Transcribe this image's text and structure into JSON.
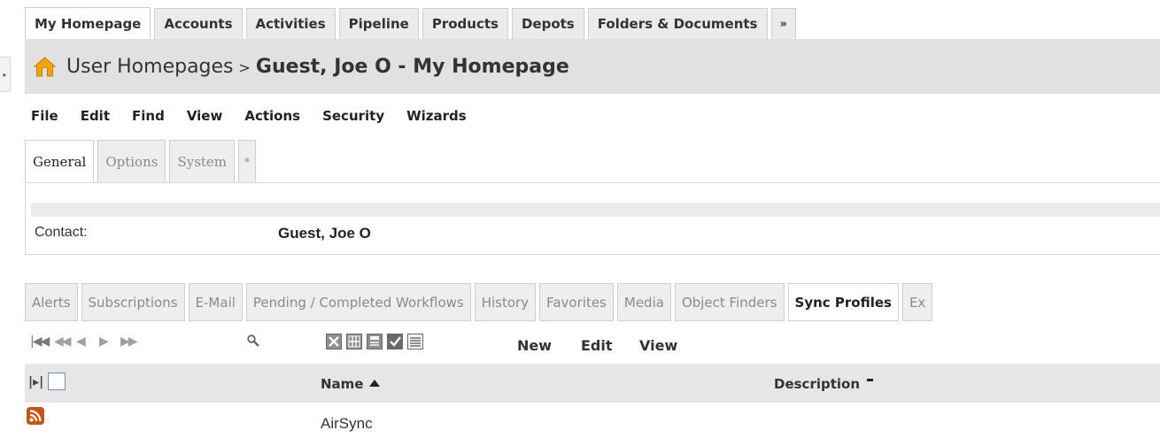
{
  "top_tabs": [
    "My Homepage",
    "Accounts",
    "Activities",
    "Pipeline",
    "Products",
    "Depots",
    "Folders & Documents",
    "»"
  ],
  "title": {
    "breadcrumb": "User Homepages",
    "separator": ">",
    "record": "Guest, Joe O - My Homepage"
  },
  "menu": [
    "File",
    "Edit",
    "Find",
    "View",
    "Actions",
    "Security",
    "Wizards"
  ],
  "detail_tabs": [
    "General",
    "Options",
    "System",
    "*"
  ],
  "detail": {
    "contact_label": "Contact:",
    "contact_value": "Guest, Joe O"
  },
  "lower_tabs": [
    "Alerts",
    "Subscriptions",
    "E-Mail",
    "Pending / Completed Workflows",
    "History",
    "Favorites",
    "Media",
    "Object Finders",
    "Sync Profiles",
    "Ex"
  ],
  "toolbar": {
    "actions": [
      "New",
      "Edit",
      "View"
    ]
  },
  "grid": {
    "columns": [
      "Name",
      "Description"
    ],
    "rows": [
      {
        "name": "AirSync"
      }
    ]
  },
  "colors": {
    "header_band": "#e1e1e1",
    "home_icon": "#f0a500",
    "rss_icon": "#c75316"
  }
}
